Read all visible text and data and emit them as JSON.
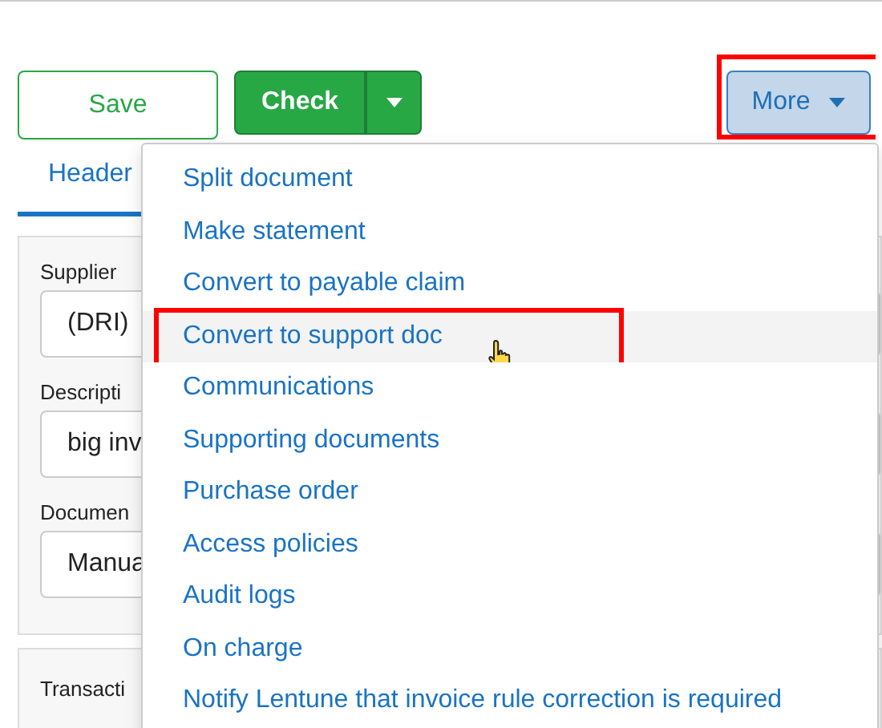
{
  "toolbar": {
    "save": "Save",
    "check": "Check",
    "more": {
      "label": "More",
      "annotated": true
    }
  },
  "tabs": [
    {
      "label": "Header",
      "selected": true
    }
  ],
  "form": [
    {
      "label": "Supplier",
      "value": "(DRI)"
    },
    {
      "label": "Descripti",
      "value": "big inv"
    },
    {
      "label": "Documen",
      "value": "Manua"
    }
  ],
  "second_panel": {
    "label": "Transacti"
  },
  "menu": [
    {
      "label": "Split document",
      "selected": false,
      "annotated": false
    },
    {
      "label": "Make statement",
      "selected": false,
      "annotated": false
    },
    {
      "label": "Convert to payable claim",
      "selected": false,
      "annotated": false
    },
    {
      "label": "Convert to support doc",
      "selected": true,
      "annotated": true
    },
    {
      "label": "Communications",
      "selected": false,
      "annotated": false
    },
    {
      "label": "Supporting documents",
      "selected": false,
      "annotated": false
    },
    {
      "label": "Purchase order",
      "selected": false,
      "annotated": false
    },
    {
      "label": "Access policies",
      "selected": false,
      "annotated": false
    },
    {
      "label": "Audit logs",
      "selected": false,
      "annotated": false
    },
    {
      "label": "On charge",
      "selected": false,
      "annotated": false
    },
    {
      "label": "Notify Lentune that invoice rule correction is required",
      "selected": false,
      "annotated": false
    }
  ]
}
